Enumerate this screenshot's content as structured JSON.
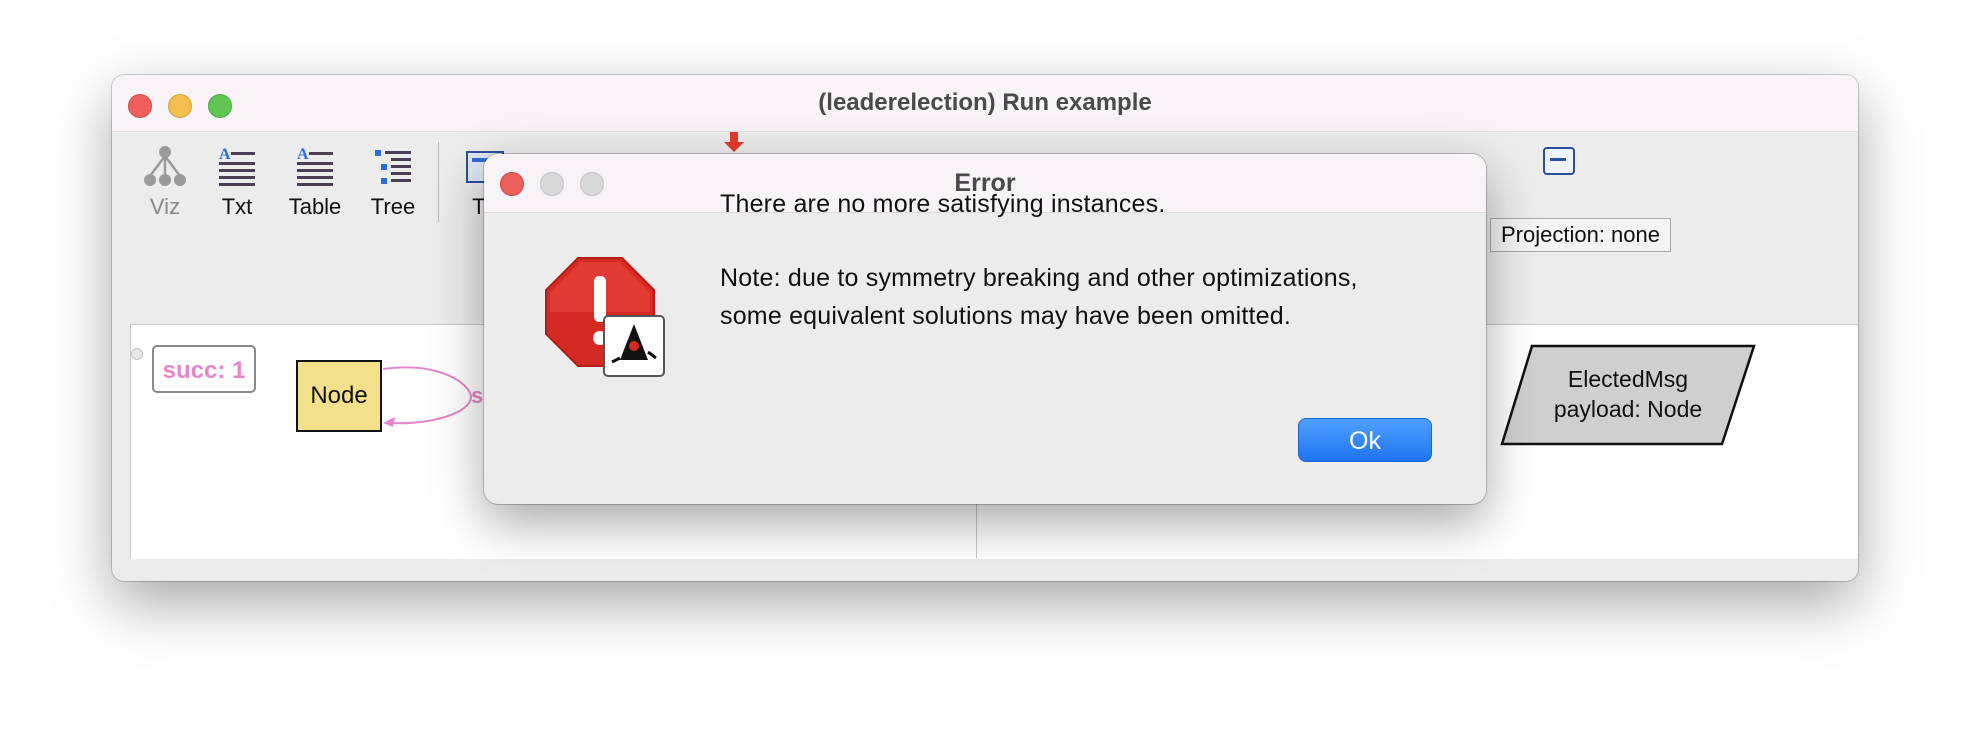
{
  "window": {
    "title": "(leaderelection) Run example"
  },
  "toolbar": {
    "items": [
      {
        "label": "Viz",
        "icon": "viz-graph-icon",
        "disabled": true
      },
      {
        "label": "Txt",
        "icon": "text-icon"
      },
      {
        "label": "Table",
        "icon": "table-icon"
      },
      {
        "label": "Tree",
        "icon": "tree-icon"
      },
      {
        "label": "Th",
        "icon": "theme-icon"
      }
    ],
    "projection_label": "Projection: none"
  },
  "canvas": {
    "succ_label": "succ: 1",
    "node_label": "Node",
    "edge_label": "su",
    "elected_msg_line1": "ElectedMsg",
    "elected_msg_line2": "payload: Node"
  },
  "dialog": {
    "title": "Error",
    "message_line1": "There are no more satisfying instances.",
    "message_line2": "Note: due to symmetry breaking and other optimizations,",
    "message_line3": "some equivalent solutions may have been omitted.",
    "ok_label": "Ok",
    "icon": "error-stop-java-icon"
  },
  "colors": {
    "accent_button": "#2a7cf5",
    "node_fill": "#f2e08b",
    "succ_text": "#e486c8",
    "stop_red": "#d42a24"
  }
}
